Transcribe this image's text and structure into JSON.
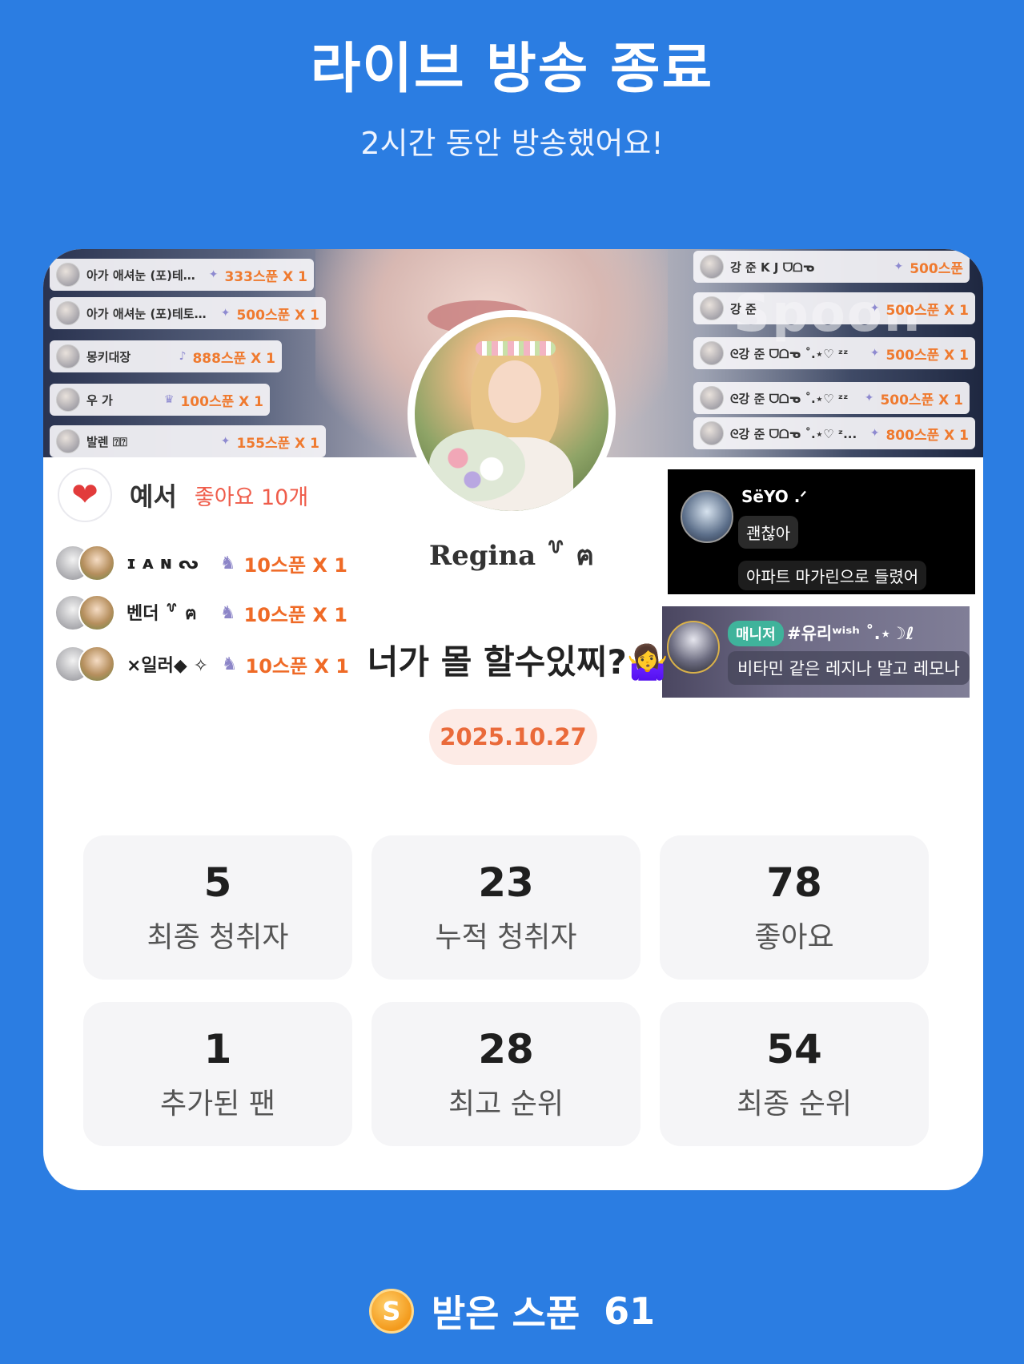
{
  "header": {
    "title": "라이브 방송 종료",
    "subtitle": "2시간 동안 방송했어요!"
  },
  "banner": {
    "watermark": "Spoon",
    "left_gifts": [
      {
        "name": "아가 애셔눈 (포)테토녀...",
        "amount": "333스푼 X 1"
      },
      {
        "name": "아가 애셔눈 (포)테토녀...",
        "amount": "500스푼 X 1"
      },
      {
        "name": "몽키대장",
        "amount": "888스푼 X 1"
      },
      {
        "name": "우 가",
        "amount": "100스푼 X 1"
      },
      {
        "name": "발렌 ⍰⍰",
        "amount": "155스푼 X 1"
      }
    ],
    "right_gifts": [
      {
        "name": "강 준 K J ᗜᗝᓀ",
        "amount": "500스푼"
      },
      {
        "name": "강 준",
        "amount": "500스푼 X 1"
      },
      {
        "name": "ᘓ강 준 ᗜᗝᓀ ˚.⋆♡ ᶻᶻ",
        "amount": "500스푼 X 1"
      },
      {
        "name": "ᘓ강 준 ᗜᗝᓀ ˚.⋆♡ ᶻᶻ",
        "amount": "500스푼 X 1"
      },
      {
        "name": "ᘓ강 준 ᗜᗝᓀ ˚.⋆♡ ᶻ...",
        "amount": "800스푼 X 1"
      }
    ]
  },
  "profile": {
    "name": "Regina ꒷ ฅ"
  },
  "likes": {
    "user": "예서",
    "count": "좋아요 10개"
  },
  "fan_gifts": [
    {
      "name": "ɪ ᴀ ɴ ᔓ",
      "amount": "10스푼 X 1"
    },
    {
      "name": "벤더 ꒷ ฅ",
      "amount": "10스푼 X 1"
    },
    {
      "name": "×일러◆ ✧",
      "amount": "10스푼 X 1"
    }
  ],
  "chats": {
    "black": {
      "user": "SëYO .ᐟ",
      "message1": "괜찮아",
      "message2": "아파트 마가린으로 들렸어"
    },
    "purple": {
      "badge": "매니저",
      "user": "#유리ʷⁱˢʰ ˚.⋆☽ℓ",
      "message": "비타민 같은 레지나 말고 레모나"
    }
  },
  "broadcast_title": "너가 몰 할수있찌?🤷‍♀️",
  "date": "2025.10.27",
  "stats": [
    {
      "value": "5",
      "label": "최종 청취자"
    },
    {
      "value": "23",
      "label": "누적 청취자"
    },
    {
      "value": "78",
      "label": "좋아요"
    },
    {
      "value": "1",
      "label": "추가된 팬"
    },
    {
      "value": "28",
      "label": "최고 순위"
    },
    {
      "value": "54",
      "label": "최종 순위"
    }
  ],
  "footer": {
    "coin_letter": "S",
    "label": "받은 스푼",
    "value": "61"
  },
  "colors": {
    "background": "#2b7de2",
    "accent_orange": "#ef6a26",
    "date_pill_bg": "#fdebe6"
  }
}
